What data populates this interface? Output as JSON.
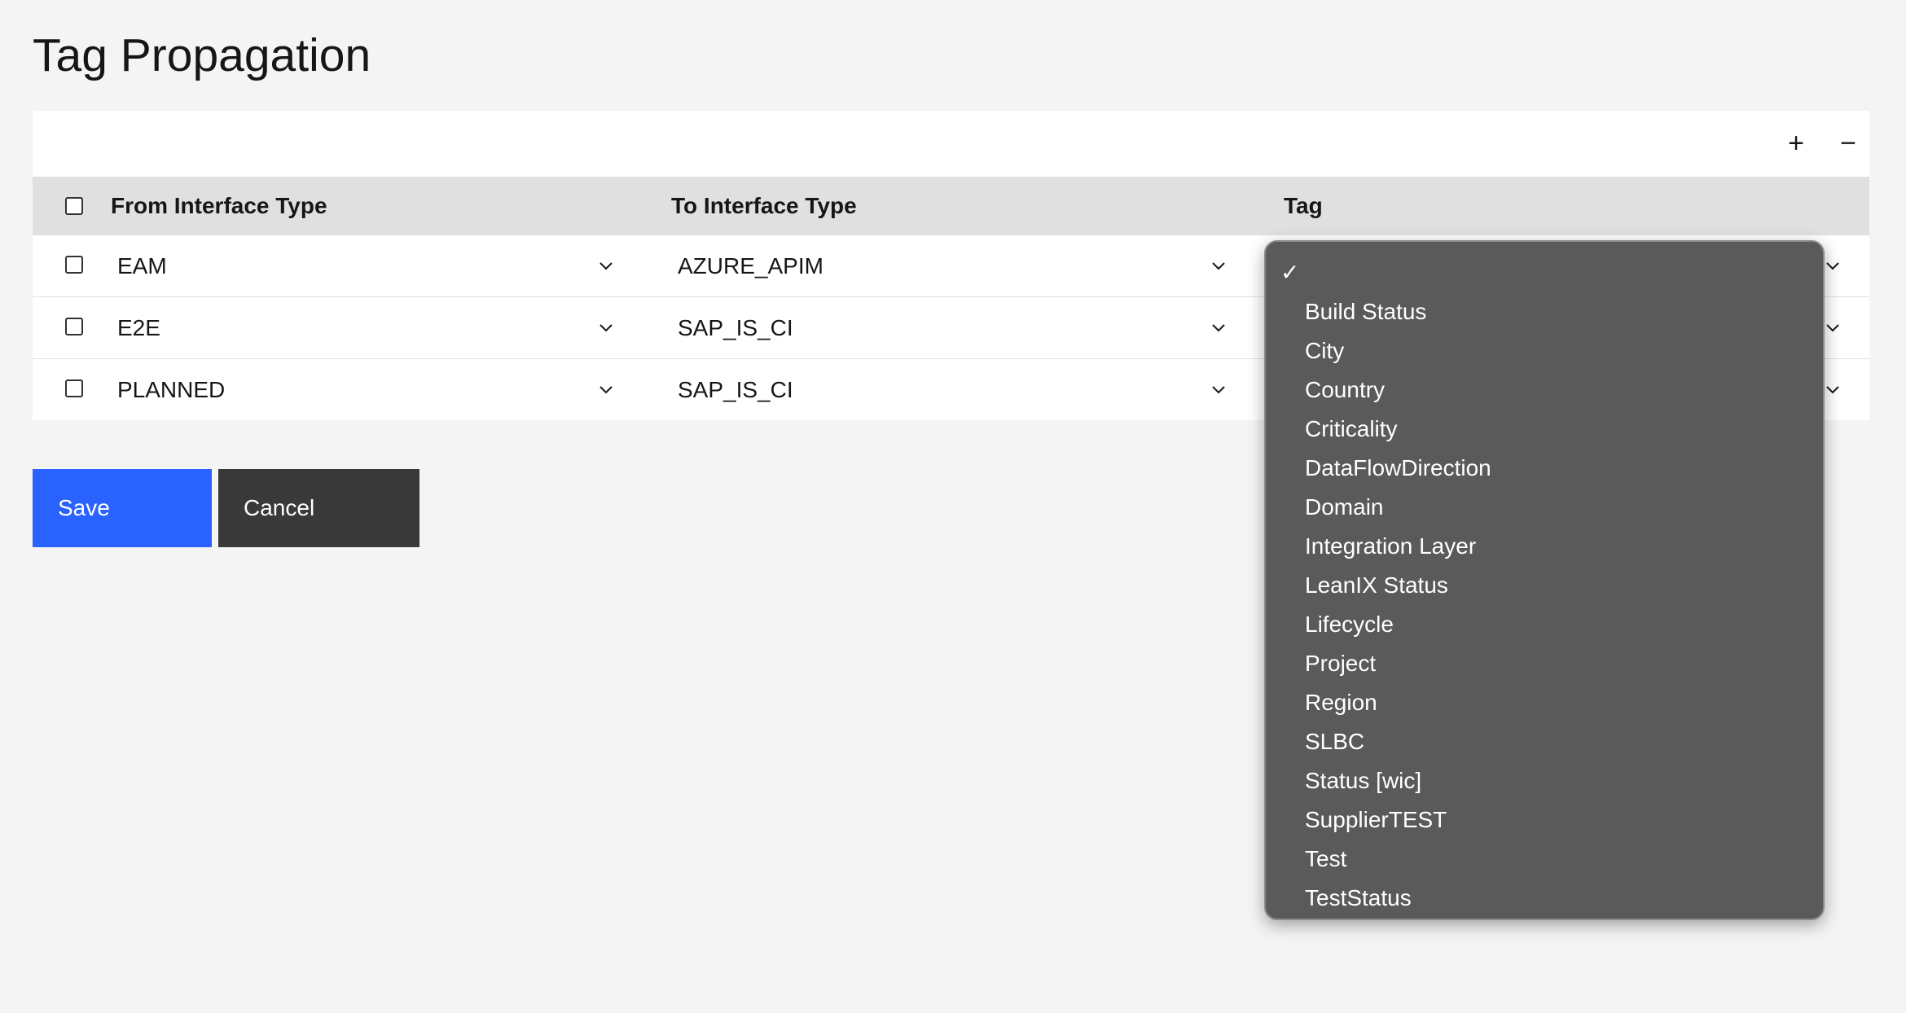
{
  "page": {
    "title": "Tag Propagation"
  },
  "toolbar": {
    "add_icon": "plus-icon",
    "add_label": "+",
    "remove_icon": "minus-icon",
    "remove_label": "−"
  },
  "table": {
    "headers": {
      "from": "From Interface Type",
      "to": "To Interface Type",
      "tag": "Tag"
    },
    "rows": [
      {
        "from": "EAM",
        "to": "AZURE_APIM",
        "tag": ""
      },
      {
        "from": "E2E",
        "to": "SAP_IS_CI",
        "tag": ""
      },
      {
        "from": "PLANNED",
        "to": "SAP_IS_CI",
        "tag": ""
      }
    ]
  },
  "actions": {
    "save_label": "Save",
    "cancel_label": "Cancel"
  },
  "dropdown": {
    "check_mark": "✓",
    "options": [
      "Build Status",
      "City",
      "Country",
      "Criticality",
      "DataFlowDirection",
      "Domain",
      "Integration Layer",
      "LeanIX Status",
      "Lifecycle",
      "Project",
      "Region",
      "SLBC",
      "Status [wic]",
      "SupplierTEST",
      "Test",
      "TestStatus"
    ]
  },
  "colors": {
    "primary": "#2962ff",
    "secondary": "#393939",
    "menu_bg": "#5a5a5a"
  }
}
